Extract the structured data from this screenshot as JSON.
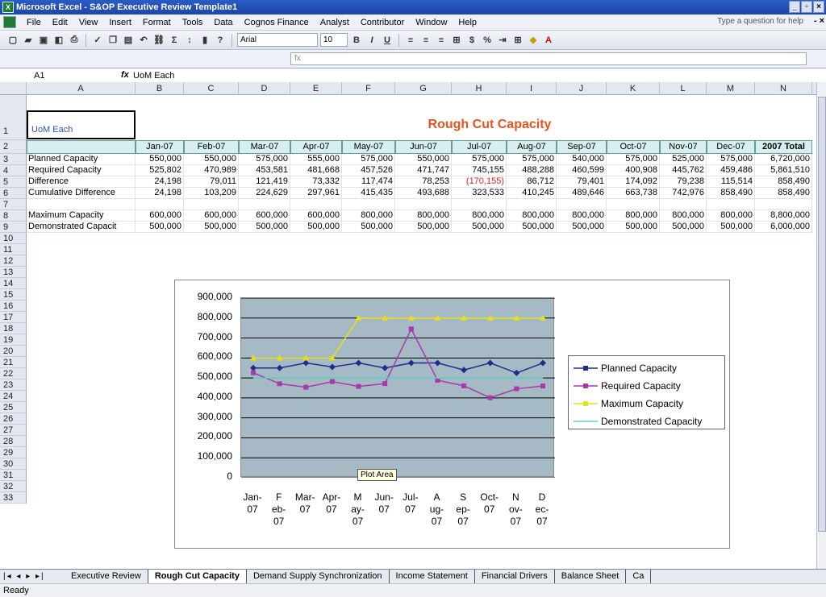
{
  "window": {
    "title": "Microsoft Excel - S&OP Executive Review Template1"
  },
  "menu": {
    "items": [
      "File",
      "Edit",
      "View",
      "Insert",
      "Format",
      "Tools",
      "Data",
      "Cognos Finance",
      "Analyst",
      "Contributor",
      "Window",
      "Help"
    ],
    "ask": "Type a question for help"
  },
  "toolbar": {
    "font": "Arial",
    "size": "10",
    "percent": "%",
    "dollar": "$"
  },
  "formula": {
    "namebox": "A1",
    "fx": "fx",
    "content": "UoM Each"
  },
  "columns": [
    "A",
    "B",
    "C",
    "D",
    "E",
    "F",
    "G",
    "H",
    "I",
    "J",
    "K",
    "L",
    "M",
    "N"
  ],
  "rows": [
    "1",
    "2",
    "3",
    "4",
    "5",
    "6",
    "7",
    "8",
    "9",
    "10",
    "11",
    "12",
    "13",
    "14",
    "15",
    "16",
    "17",
    "18",
    "19",
    "20",
    "21",
    "22",
    "23",
    "24",
    "25",
    "26",
    "27",
    "28",
    "29",
    "30",
    "31",
    "32",
    "33"
  ],
  "sheet": {
    "a1": "UoM Each",
    "title": "Rough Cut Capacity",
    "months": [
      "Jan-07",
      "Feb-07",
      "Mar-07",
      "Apr-07",
      "May-07",
      "Jun-07",
      "Jul-07",
      "Aug-07",
      "Sep-07",
      "Oct-07",
      "Nov-07",
      "Dec-07",
      "2007 Total"
    ],
    "data": [
      {
        "label": "Planned Capacity",
        "values": [
          "550,000",
          "550,000",
          "575,000",
          "555,000",
          "575,000",
          "550,000",
          "575,000",
          "575,000",
          "540,000",
          "575,000",
          "525,000",
          "575,000",
          "6,720,000"
        ]
      },
      {
        "label": "Required Capacity",
        "values": [
          "525,802",
          "470,989",
          "453,581",
          "481,668",
          "457,526",
          "471,747",
          "745,155",
          "488,288",
          "460,599",
          "400,908",
          "445,762",
          "459,486",
          "5,861,510"
        ]
      },
      {
        "label": "Difference",
        "values": [
          "24,198",
          "79,011",
          "121,419",
          "73,332",
          "117,474",
          "78,253",
          "(170,155)",
          "86,712",
          "79,401",
          "174,092",
          "79,238",
          "115,514",
          "858,490"
        ]
      },
      {
        "label": "Cumulative Difference",
        "values": [
          "24,198",
          "103,209",
          "224,629",
          "297,961",
          "415,435",
          "493,688",
          "323,533",
          "410,245",
          "489,646",
          "663,738",
          "742,976",
          "858,490",
          "858,490"
        ]
      },
      {
        "label": "",
        "values": [
          "",
          "",
          "",
          "",
          "",
          "",
          "",
          "",
          "",
          "",
          "",
          "",
          ""
        ]
      },
      {
        "label": "Maximum Capacity",
        "values": [
          "600,000",
          "600,000",
          "600,000",
          "600,000",
          "800,000",
          "800,000",
          "800,000",
          "800,000",
          "800,000",
          "800,000",
          "800,000",
          "800,000",
          "8,800,000"
        ]
      },
      {
        "label": "Demonstrated Capacit",
        "values": [
          "500,000",
          "500,000",
          "500,000",
          "500,000",
          "500,000",
          "500,000",
          "500,000",
          "500,000",
          "500,000",
          "500,000",
          "500,000",
          "500,000",
          "6,000,000"
        ]
      }
    ]
  },
  "chart_data": {
    "type": "line",
    "categories": [
      "Jan-07",
      "Feb-07",
      "Mar-07",
      "Apr-07",
      "May-07",
      "Jun-07",
      "Jul-07",
      "Aug-07",
      "Sep-07",
      "Oct-07",
      "Nov-07",
      "Dec-07"
    ],
    "xtick_labels": [
      "Jan- 07",
      "F eb- 07",
      "Mar- 07",
      "Apr- 07",
      "M ay- 07",
      "Jun- 07",
      "Jul- 07",
      "A ug- 07",
      "S ep- 07",
      "Oct- 07",
      "N ov- 07",
      "D ec- 07"
    ],
    "ylim": [
      0,
      900000
    ],
    "yticks": [
      "0",
      "100,000",
      "200,000",
      "300,000",
      "400,000",
      "500,000",
      "600,000",
      "700,000",
      "800,000",
      "900,000"
    ],
    "grid": true,
    "legend": "right",
    "series": [
      {
        "name": "Planned Capacity",
        "color": "#1f2d8c",
        "marker": "diamond",
        "values": [
          550000,
          550000,
          575000,
          555000,
          575000,
          550000,
          575000,
          575000,
          540000,
          575000,
          525000,
          575000
        ]
      },
      {
        "name": "Required Capacity",
        "color": "#a83aa8",
        "marker": "square",
        "values": [
          525802,
          470989,
          453581,
          481668,
          457526,
          471747,
          745155,
          488288,
          460599,
          400908,
          445762,
          459486
        ]
      },
      {
        "name": "Maximum Capacity",
        "color": "#e6e01c",
        "marker": "triangle",
        "values": [
          600000,
          600000,
          600000,
          600000,
          800000,
          800000,
          800000,
          800000,
          800000,
          800000,
          800000,
          800000
        ]
      },
      {
        "name": "Demonstrated Capacity",
        "color": "#5fd0c8",
        "marker": "none",
        "values": [
          500000,
          500000,
          500000,
          500000,
          500000,
          500000,
          500000,
          500000,
          500000,
          500000,
          500000,
          500000
        ]
      }
    ],
    "tooltip": "Plot Area"
  },
  "tabs": {
    "items": [
      "Executive Review",
      "Rough Cut Capacity",
      "Demand Supply Synchronization",
      "Income Statement",
      "Financial Drivers",
      "Balance Sheet",
      "Ca"
    ],
    "active": 1
  },
  "status": "Ready"
}
